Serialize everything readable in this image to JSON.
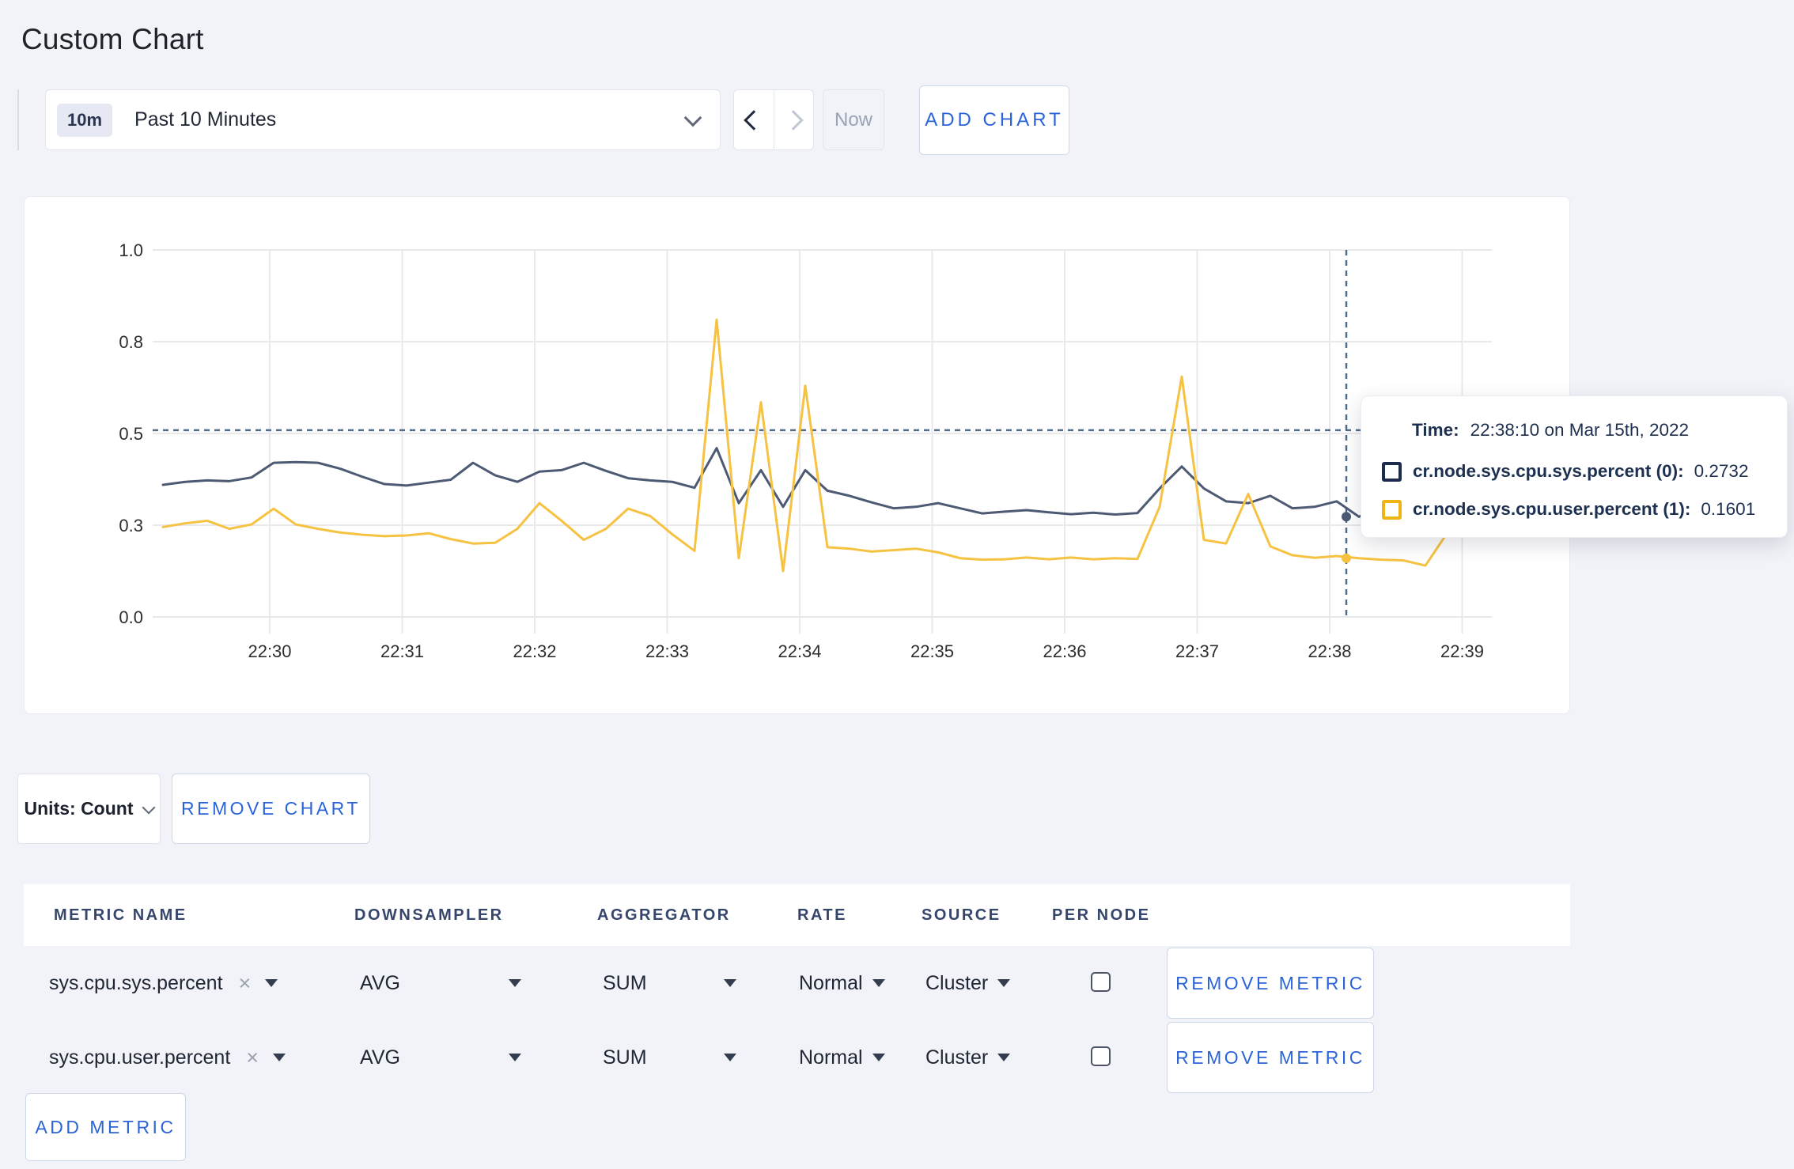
{
  "page": {
    "title": "Custom Chart",
    "accent_blue": "#2b63d9",
    "background": "#f1f3f8"
  },
  "toolbar": {
    "range_badge": "10m",
    "range_label": "Past 10 Minutes",
    "now_label": "Now",
    "add_chart_label": "ADD CHART"
  },
  "chart_data": {
    "type": "line",
    "title": "",
    "xlabel": "",
    "ylabel": "",
    "ylim": [
      0,
      1.0
    ],
    "grid": true,
    "x_ticks": [
      "22:30",
      "22:31",
      "22:32",
      "22:33",
      "22:34",
      "22:35",
      "22:36",
      "22:37",
      "22:38",
      "22:39"
    ],
    "y_ticks": [
      {
        "label": "0.0",
        "pos": 0
      },
      {
        "label": "0.3",
        "pos": 0.25
      },
      {
        "label": "0.5",
        "pos": 0.5
      },
      {
        "label": "0.8",
        "pos": 0.75
      },
      {
        "label": "1.0",
        "pos": 1.0
      }
    ],
    "start_time": "22:29:15",
    "interval_seconds": 10,
    "series": [
      {
        "name": "cr.node.sys.cpu.sys.percent",
        "color": "#4d5a73",
        "values": [
          0.36,
          0.368,
          0.372,
          0.37,
          0.38,
          0.42,
          0.422,
          0.42,
          0.404,
          0.382,
          0.362,
          0.358,
          0.366,
          0.374,
          0.42,
          0.386,
          0.368,
          0.396,
          0.4,
          0.42,
          0.398,
          0.378,
          0.372,
          0.368,
          0.352,
          0.46,
          0.31,
          0.4,
          0.3,
          0.4,
          0.344,
          0.33,
          0.312,
          0.296,
          0.3,
          0.31,
          0.296,
          0.282,
          0.287,
          0.291,
          0.285,
          0.28,
          0.284,
          0.279,
          0.283,
          0.35,
          0.41,
          0.35,
          0.315,
          0.31,
          0.33,
          0.296,
          0.3,
          0.315,
          0.273,
          0.3,
          0.305,
          0.299,
          0.303,
          0.3
        ]
      },
      {
        "name": "cr.node.sys.cpu.user.percent",
        "color": "#f5c242",
        "values": [
          0.245,
          0.255,
          0.262,
          0.24,
          0.252,
          0.295,
          0.252,
          0.24,
          0.23,
          0.224,
          0.22,
          0.222,
          0.228,
          0.212,
          0.2,
          0.202,
          0.24,
          0.31,
          0.262,
          0.21,
          0.24,
          0.295,
          0.275,
          0.225,
          0.18,
          0.81,
          0.16,
          0.585,
          0.125,
          0.63,
          0.19,
          0.186,
          0.178,
          0.182,
          0.186,
          0.176,
          0.16,
          0.156,
          0.157,
          0.162,
          0.157,
          0.162,
          0.157,
          0.16,
          0.158,
          0.3,
          0.655,
          0.21,
          0.2,
          0.335,
          0.192,
          0.168,
          0.161,
          0.166,
          0.16,
          0.156,
          0.154,
          0.14,
          0.23,
          0.28
        ]
      }
    ],
    "crosshair": {
      "time": "22:38:10",
      "pointer_value": 0.509,
      "sys_value": 0.2732,
      "user_value": 0.1601
    }
  },
  "tooltip": {
    "time_label": "Time:",
    "time_value": "22:38:10 on Mar 15th, 2022",
    "series": [
      {
        "name": "cr.node.sys.cpu.sys.percent (0):",
        "value": "0.2732",
        "swatch_color": "#1d2c4e"
      },
      {
        "name": "cr.node.sys.cpu.user.percent (1):",
        "value": "0.1601",
        "swatch_color": "#edb414"
      }
    ]
  },
  "chart_footer": {
    "units_label": "Units: Count",
    "remove_chart_label": "REMOVE CHART"
  },
  "metrics_table": {
    "headers": {
      "metric": "METRIC NAME",
      "downsampler": "DOWNSAMPLER",
      "aggregator": "AGGREGATOR",
      "rate": "RATE",
      "source": "SOURCE",
      "per_node": "PER NODE"
    },
    "clear_glyph": "×",
    "rows": [
      {
        "metric": "sys.cpu.sys.percent",
        "downsampler": "AVG",
        "aggregator": "SUM",
        "rate": "Normal",
        "source": "Cluster",
        "per_node_checked": false,
        "remove_label": "REMOVE METRIC"
      },
      {
        "metric": "sys.cpu.user.percent",
        "downsampler": "AVG",
        "aggregator": "SUM",
        "rate": "Normal",
        "source": "Cluster",
        "per_node_checked": false,
        "remove_label": "REMOVE METRIC"
      }
    ],
    "add_metric_label": "ADD METRIC"
  }
}
